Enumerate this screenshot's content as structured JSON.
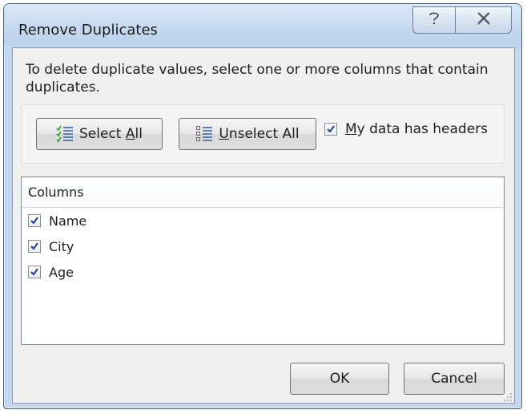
{
  "window": {
    "title": "Remove Duplicates",
    "help_icon": "question-mark-icon",
    "close_icon": "close-x-icon"
  },
  "instruction": "To delete duplicate values, select one or more columns that contain duplicates.",
  "toolbar": {
    "select_all": {
      "before": "Select ",
      "accel": "A",
      "after": "ll",
      "icon": "select-all-list-icon"
    },
    "unselect_all": {
      "before": "",
      "accel": "U",
      "after": "nselect All",
      "icon": "unselect-all-list-icon"
    },
    "headers": {
      "checked": true,
      "accel": "M",
      "after": "y data has headers"
    }
  },
  "columns": {
    "header": "Columns",
    "items": [
      {
        "label": "Name",
        "checked": true
      },
      {
        "label": "City",
        "checked": true
      },
      {
        "label": "Age",
        "checked": true
      }
    ]
  },
  "footer": {
    "ok": "OK",
    "cancel": "Cancel"
  },
  "colors": {
    "frame": "#c3d8ee",
    "client": "#f0f0f0",
    "check_mark": "#1c3f95",
    "select_icon_green": "#3aa53a"
  }
}
